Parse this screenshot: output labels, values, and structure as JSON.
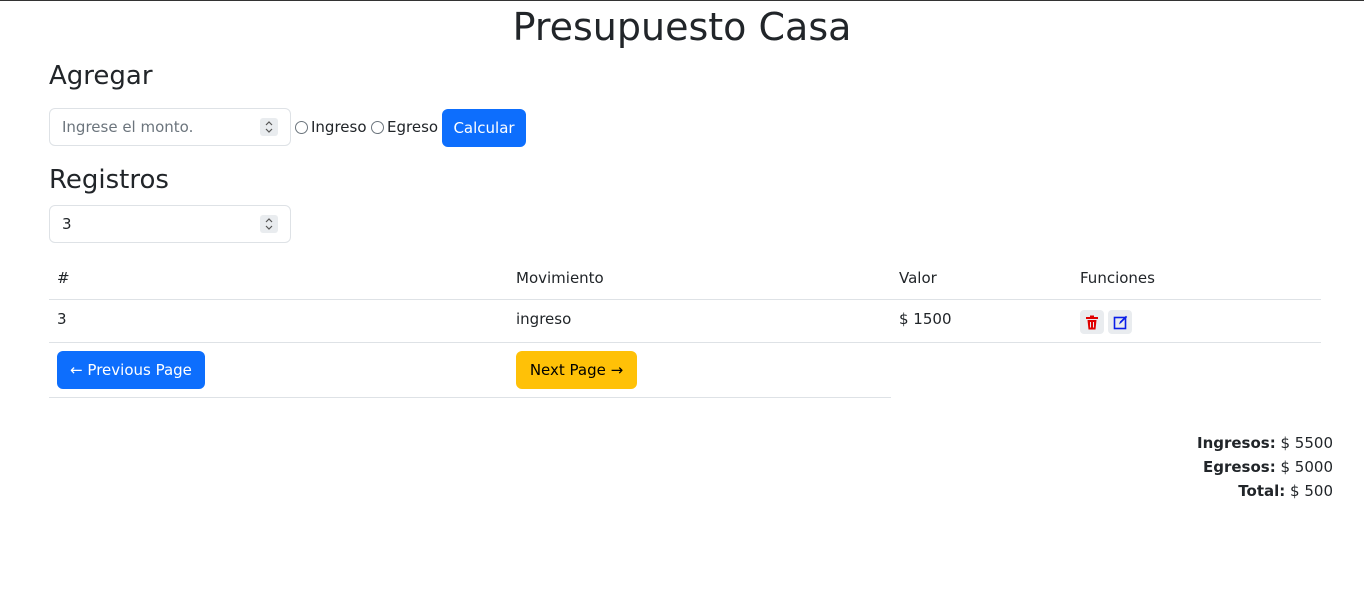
{
  "page": {
    "title": "Presupuesto Casa"
  },
  "agregar": {
    "title": "Agregar",
    "amount_placeholder": "Ingrese el monto.",
    "radio_ingreso": "Ingreso",
    "radio_egreso": "Egreso",
    "calcular_label": "Calcular"
  },
  "registros": {
    "title": "Registros",
    "count_value": "3"
  },
  "table": {
    "headers": [
      "#",
      "Movimiento",
      "Valor",
      "Funciones"
    ],
    "rows": [
      {
        "id": "3",
        "movimiento": "ingreso",
        "valor": "$ 1500"
      }
    ]
  },
  "pagination": {
    "prev_label": "← Previous Page",
    "next_label": "Next Page →"
  },
  "totals": {
    "ingresos_label": "Ingresos:",
    "ingresos_value": "$ 5500",
    "egresos_label": "Egresos:",
    "egresos_value": "$ 5000",
    "total_label": "Total:",
    "total_value": "$ 500"
  },
  "colors": {
    "primary": "#0d6efd",
    "warning": "#ffc107",
    "delete_icon": "#e00000",
    "edit_icon": "#0a1ee8"
  },
  "icons": {
    "delete": "trash-icon",
    "edit": "edit-icon"
  }
}
